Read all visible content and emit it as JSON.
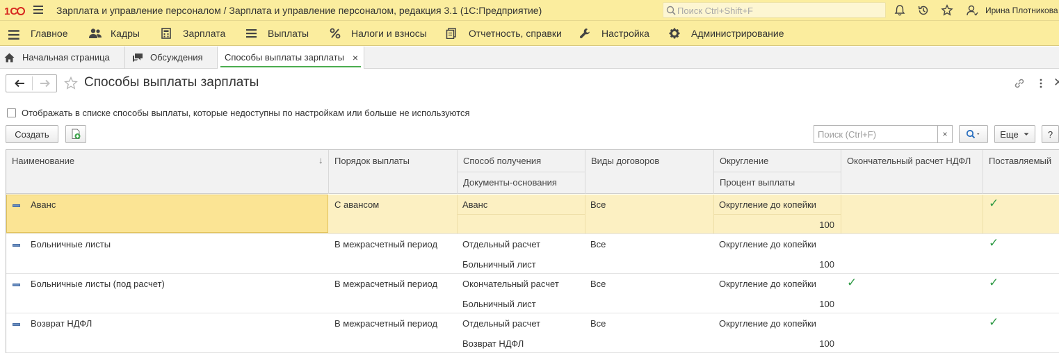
{
  "titlebar": {
    "app_title": "Зарплата и управление персоналом / Зарплата и управление персоналом, редакция 3.1  (1С:Предприятие)",
    "search_placeholder": "Поиск Ctrl+Shift+F",
    "user_name": "Ирина Плотникова",
    "icons": [
      "logo-1c-icon",
      "menu-icon",
      "search-icon",
      "bell-icon",
      "history-icon",
      "star-icon",
      "user-icon"
    ]
  },
  "sections": [
    {
      "label": "Главное",
      "icon": "burger-icon"
    },
    {
      "label": "Кадры",
      "icon": "people-icon"
    },
    {
      "label": "Зарплата",
      "icon": "calculator-icon"
    },
    {
      "label": "Выплаты",
      "icon": "list-icon"
    },
    {
      "label": "Налоги и взносы",
      "icon": "percent-icon"
    },
    {
      "label": "Отчетность, справки",
      "icon": "reports-icon"
    },
    {
      "label": "Настройка",
      "icon": "wrench-icon"
    },
    {
      "label": "Администрирование",
      "icon": "gear-icon"
    }
  ],
  "tabs": [
    {
      "label": "Начальная страница",
      "icon": "home-icon"
    },
    {
      "label": "Обсуждения",
      "icon": "chat-icon"
    },
    {
      "label": "Способы выплаты зарплаты",
      "close": "×",
      "active": true
    }
  ],
  "form": {
    "title": "Способы выплаты зарплаты",
    "show_unavailable_label": "Отображать в списке способы выплаты, которые недоступны по настройкам или больше не используются",
    "show_unavailable_checked": false
  },
  "toolbar": {
    "create_label": "Создать",
    "search_placeholder": "Поиск (Ctrl+F)",
    "clear_label": "×",
    "more_label": "Еще",
    "help_label": "?"
  },
  "columns": {
    "name": "Наименование",
    "sort_indicator": "↓",
    "order": "Порядок выплаты",
    "method": "Способ получения",
    "basis_docs": "Документы-основания",
    "contract_types": "Виды договоров",
    "rounding": "Округление",
    "percent": "Процент выплаты",
    "final_ndfl": "Окончательный расчет НДФЛ",
    "supplied": "Поставляемый"
  },
  "rows": [
    {
      "name": "Аванс",
      "order": "С авансом",
      "method": "Аванс",
      "basis": "",
      "contracts": "Все",
      "rounding": "Округление до копейки",
      "percent": "100",
      "final_ndfl": "",
      "supplied": "✓"
    },
    {
      "name": "Больничные листы",
      "order": "В межрасчетный период",
      "method": "Отдельный расчет",
      "basis": "Больничный лист",
      "contracts": "Все",
      "rounding": "Округление до копейки",
      "percent": "100",
      "final_ndfl": "",
      "supplied": "✓"
    },
    {
      "name": "Больничные листы (под расчет)",
      "order": "В межрасчетный период",
      "method": "Окончательный расчет",
      "basis": "Больничный лист",
      "contracts": "Все",
      "rounding": "Округление до копейки",
      "percent": "100",
      "final_ndfl": "✓",
      "supplied": "✓"
    },
    {
      "name": "Возврат НДФЛ",
      "order": "В межрасчетный период",
      "method": "Отдельный расчет",
      "basis": "Возврат НДФЛ",
      "contracts": "Все",
      "rounding": "Округление до копейки",
      "percent": "100",
      "final_ndfl": "",
      "supplied": "✓"
    }
  ],
  "colors": {
    "accent_yellow": "#fbed9e",
    "selected_row": "#fcf0c2",
    "check_green": "#2f9a45",
    "active_tab_underline": "#4bad4f"
  }
}
